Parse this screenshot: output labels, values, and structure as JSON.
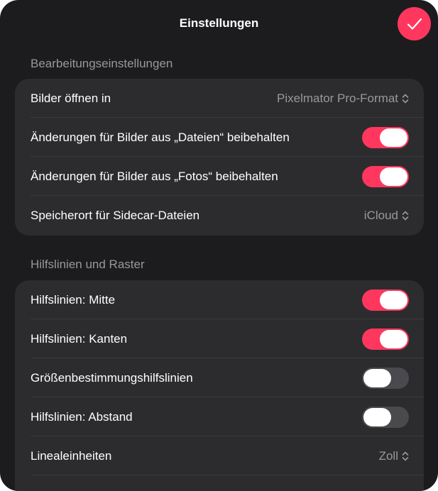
{
  "header": {
    "title": "Einstellungen",
    "done_icon": "checkmark-icon",
    "accent_color": "#ff375f"
  },
  "sections": [
    {
      "header": "Bearbeitungseinstellungen",
      "rows": [
        {
          "label": "Bilder öffnen in",
          "type": "picker",
          "value": "Pixelmator Pro-Format"
        },
        {
          "label": "Änderungen für Bilder aus „Dateien“ beibehalten",
          "type": "toggle",
          "on": true
        },
        {
          "label": "Änderungen für Bilder aus „Fotos“ beibehalten",
          "type": "toggle",
          "on": true
        },
        {
          "label": "Speicherort für Sidecar-Dateien",
          "type": "picker",
          "value": "iCloud"
        }
      ]
    },
    {
      "header": "Hilfslinien und Raster",
      "rows": [
        {
          "label": "Hilfslinien: Mitte",
          "type": "toggle",
          "on": true
        },
        {
          "label": "Hilfslinien: Kanten",
          "type": "toggle",
          "on": true
        },
        {
          "label": "Größenbestimmungshilfslinien",
          "type": "toggle",
          "on": false
        },
        {
          "label": "Hilfslinien: Abstand",
          "type": "toggle",
          "on": false
        },
        {
          "label": "Linealeinheiten",
          "type": "picker",
          "value": "Zoll"
        }
      ]
    }
  ]
}
